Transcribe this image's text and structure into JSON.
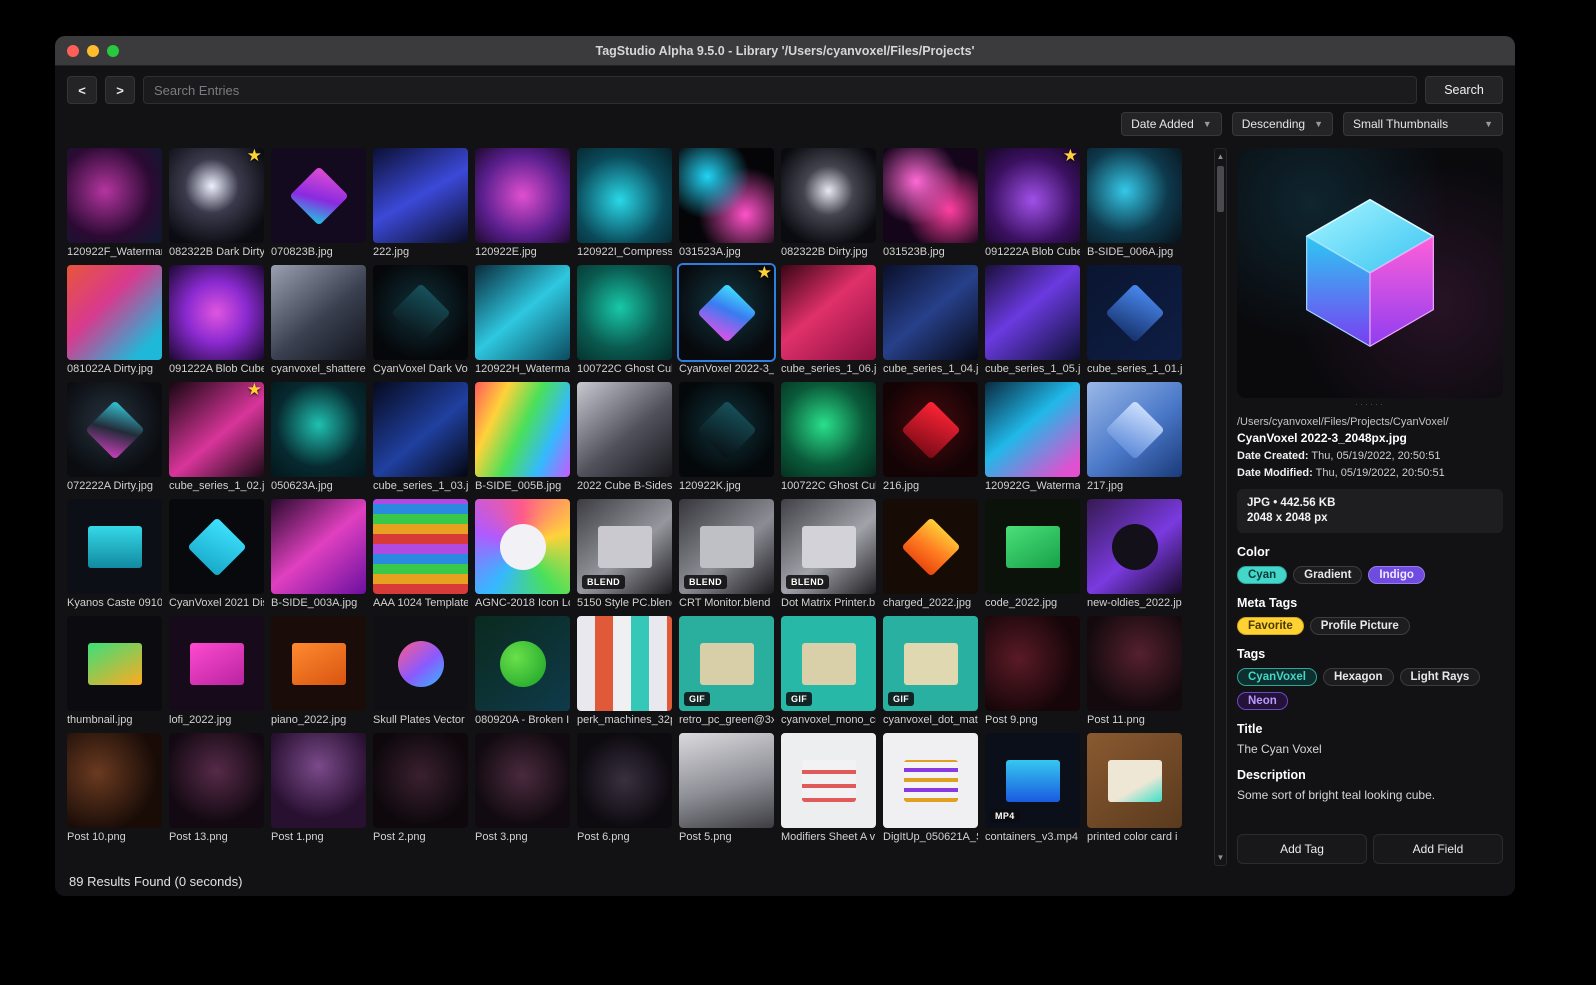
{
  "window": {
    "title": "TagStudio Alpha 9.5.0 - Library '/Users/cyanvoxel/Files/Projects'",
    "status": "89 Results Found (0 seconds)"
  },
  "toolbar": {
    "back": "<",
    "forward": ">",
    "search_placeholder": "Search Entries",
    "search_button": "Search"
  },
  "filters": {
    "sort_field": "Date Added",
    "sort_order": "Descending",
    "thumb_size": "Small Thumbnails"
  },
  "colors": {
    "accent_selection": "#2e7fe0",
    "star": "#ffd234"
  },
  "grid": {
    "items": [
      {
        "name": "120922F_Watermar",
        "bg": "radial-gradient(circle at 40% 45%,#b435a0,#2b0a33 60%,#0c1b2e)"
      },
      {
        "name": "082322B Dark Dirty",
        "bg": "radial-gradient(circle at 45% 40%,#eef0ff,#3a3a4c 35%,#0b0b12 80%)",
        "badge": "star"
      },
      {
        "name": "070823B.jpg",
        "bg": "#140a20",
        "fg": "linear-gradient(150deg,#e14fd0,#8a2ae0 55%,#20c8e0)"
      },
      {
        "name": "222.jpg",
        "bg": "linear-gradient(150deg,#0b1033,#3b49d8 50%,#0a0d22)"
      },
      {
        "name": "120922E.jpg",
        "bg": "radial-gradient(circle at 50% 50%,#e04fd0,#5a1f8e 60%,#1e0a2e)"
      },
      {
        "name": "120922I_Compresse",
        "bg": "radial-gradient(circle at 45% 55%,#29d8e8,#0a4a5a 60%,#072028)"
      },
      {
        "name": "031523A.jpg",
        "bg": "radial-gradient(circle at 30% 30%,#22d4f5,rgba(0,0,0,0) 45%),radial-gradient(circle at 70% 70%,#ff52c8,rgba(0,0,0,0) 50%),#050508"
      },
      {
        "name": "082322B Dirty.jpg",
        "bg": "radial-gradient(circle at 50% 45%,#e8e8f2,#44444f 35%,#0a0a10 80%)"
      },
      {
        "name": "031523B.jpg",
        "bg": "radial-gradient(circle at 35% 35%,#ff6ad5,rgba(0,0,0,0) 50%),radial-gradient(circle at 70% 65%,#ff3fa0,rgba(0,0,0,0) 50%),#14051a"
      },
      {
        "name": "091222A Blob Cube",
        "bg": "radial-gradient(circle at 50% 55%,#a050e8,#3a1060 60%,#140720)",
        "badge": "star"
      },
      {
        "name": "B-SIDE_006A.jpg",
        "bg": "radial-gradient(circle at 40% 45%,#35c8e8,#0e3a4d 55%,#081018)"
      },
      {
        "name": "081022A Dirty.jpg",
        "bg": "linear-gradient(135deg,#e8553a 0%,#d83a8e 40%,#20b8d8 85%)"
      },
      {
        "name": "091222A Blob Cube",
        "bg": "radial-gradient(circle at 50% 50%,#e055e0,#8a2ad0 45%,#1a0830)"
      },
      {
        "name": "cyanvoxel_shattere",
        "bg": "linear-gradient(140deg,#9aa0b0,#3a4050 55%,#12141c)"
      },
      {
        "name": "CyanVoxel Dark Vox",
        "bg": "radial-gradient(circle at 50% 45%,#0f3038,#05070a 75%)",
        "fg": "linear-gradient(160deg,#17535e,#0a1418)"
      },
      {
        "name": "120922H_Waterma",
        "bg": "linear-gradient(140deg,#0a2a3a,#2ec8e0 50%,#0c4a5e)"
      },
      {
        "name": "100722C Ghost Cub",
        "bg": "radial-gradient(circle at 45% 45%,#18c8a8,#0a5a50 55%,#042a28)"
      },
      {
        "name": "CyanVoxel 2022-3_",
        "bg": "radial-gradient(circle at 50% 42%,#123741,#07090d 75%)",
        "fg": "linear-gradient(160deg,#3fe2ff 0%,#3a7bf0 45%,#e052e8 100%)",
        "badge": "star",
        "sel": true
      },
      {
        "name": "cube_series_1_06.j",
        "bg": "linear-gradient(140deg,#3a0515,#e0306a 45%,#8a1040)"
      },
      {
        "name": "cube_series_1_04.j",
        "bg": "linear-gradient(140deg,#0a0f2a,#27408a 50%,#060814)"
      },
      {
        "name": "cube_series_1_05.j",
        "bg": "linear-gradient(140deg,#1a0f3a,#6a3ae0 45%,#0c1030)"
      },
      {
        "name": "cube_series_1_01.j",
        "bg": "linear-gradient(140deg,#0a1530,#0e1d44)",
        "fg": "linear-gradient(160deg,#4a8af0,#16306a)"
      },
      {
        "name": "072222A Dirty.jpg",
        "bg": "radial-gradient(circle at 45% 42%,#26323e,#0a0c10 72%)",
        "fg": "linear-gradient(150deg,#35c8d8,#232b38 50%,#d040c0)"
      },
      {
        "name": "cube_series_1_02.j",
        "bg": "linear-gradient(140deg,#16060f,#d8359a 55%,#1a0a14)",
        "badge": "star"
      },
      {
        "name": "050623A.jpg",
        "bg": "radial-gradient(circle at 50% 45%,#20c0b0,#062a30 60%,#03161a)"
      },
      {
        "name": "cube_series_1_03.j",
        "bg": "linear-gradient(140deg,#060a1e,#2040a0 55%,#04060f)"
      },
      {
        "name": "B-SIDE_005B.jpg",
        "bg": "linear-gradient(115deg,#ff5a5a 0%,#ffd23a 25%,#4ae05a 50%,#35b8ff 75%,#c85aff 100%)"
      },
      {
        "name": "2022 Cube B-Sides",
        "bg": "linear-gradient(140deg,#c9c9d2,#51515c 55%,#17171c)"
      },
      {
        "name": "120922K.jpg",
        "bg": "radial-gradient(circle at 50% 45%,#10343c,#04080a 72%)",
        "fg": "linear-gradient(160deg,#17525c,#081014)"
      },
      {
        "name": "100722C Ghost Cub",
        "bg": "radial-gradient(circle at 45% 45%,#2ae08a,#0a5a3a 55%,#04261a)"
      },
      {
        "name": "216.jpg",
        "bg": "radial-gradient(circle at 50% 45%,#4a0a0e,#130305 72%)",
        "fg": "linear-gradient(160deg,#ff2436,#7a0a16)"
      },
      {
        "name": "120922G_Waterma",
        "bg": "linear-gradient(140deg,#0a2a40,#20b8e8 45%,#e050d0 90%)"
      },
      {
        "name": "217.jpg",
        "bg": "linear-gradient(140deg,#9ab8e8,#4a78c8 55%,#1a3a7a)",
        "fg": "linear-gradient(160deg,#cfe2ff,#5a88d8)"
      },
      {
        "name": "Kyanos Caste 0910",
        "bg": "#0c1016",
        "fg": "linear-gradient(180deg,#35d8e8,#128aa0)",
        "fs": "s"
      },
      {
        "name": "CyanVoxel 2021 Dis",
        "bg": "#08090c",
        "fg": "linear-gradient(160deg,#3fe2ff,#18a8c8)"
      },
      {
        "name": "B-SIDE_003A.jpg",
        "bg": "linear-gradient(140deg,#2a0a2e,#e040c0 50%,#6a10a0)"
      },
      {
        "name": "AAA 1024 Template",
        "bg": "repeating-linear-gradient(0deg,#d83a3a 0 10px,#e8a020 10px 20px,#3ac84a 20px 30px,#2a8ae0 30px 40px,#b04ae0 40px 50px)"
      },
      {
        "name": "AGNC-2018 Icon Lo",
        "bg": "conic-gradient(from 0deg,#ff5a8a,#ffd23a,#4ae05a,#35b8ff,#b05aff,#ff5a8a)",
        "fg": "#f2f2f6",
        "fs": "c"
      },
      {
        "name": "5150 Style PC.blend",
        "bg": "linear-gradient(140deg,#3c3c42,#96969e 55%,#1c1c20)",
        "fg": "#c9c9cf",
        "fs": "s",
        "badge": "BLEND"
      },
      {
        "name": "CRT Monitor.blend",
        "bg": "linear-gradient(140deg,#36363c,#8c8c94 55%,#1a1a1e)",
        "fg": "#bfbfc6",
        "fs": "s",
        "badge": "BLEND"
      },
      {
        "name": "Dot Matrix Printer.b",
        "bg": "linear-gradient(140deg,#404046,#a2a2aa 55%,#202024)",
        "fg": "#d2d2d8",
        "fs": "s",
        "badge": "BLEND"
      },
      {
        "name": "charged_2022.jpg",
        "bg": "#160b05",
        "fg": "linear-gradient(170deg,#ffd23a,#ff7a20 55%,#e8440e)"
      },
      {
        "name": "code_2022.jpg",
        "bg": "#0a120a",
        "fg": "linear-gradient(150deg,#4ae07a,#17a048)",
        "fs": "s"
      },
      {
        "name": "new-oldies_2022.jp",
        "bg": "linear-gradient(140deg,#351a50,#7a3ae0 55%,#180a28)",
        "fg": "#14101a",
        "fs": "c"
      },
      {
        "name": "thumbnail.jpg",
        "bg": "#0c0c10",
        "fg": "linear-gradient(150deg,#3ae07a,#ffaa20)",
        "fs": "s"
      },
      {
        "name": "lofi_2022.jpg",
        "bg": "#170a1a",
        "fg": "linear-gradient(150deg,#ff4ad0,#b824a0)",
        "fs": "s"
      },
      {
        "name": "piano_2022.jpg",
        "bg": "#1a0c08",
        "fg": "linear-gradient(150deg,#ff8a30,#d85510)",
        "fs": "s"
      },
      {
        "name": "Skull Plates Vector",
        "bg": "#0f0f14",
        "fg": "linear-gradient(140deg,#ff5a8a,#8a5aff 55%,#35b8ff)",
        "fs": "c"
      },
      {
        "name": "080920A - Broken I",
        "bg": "linear-gradient(140deg,#0a2a1e,#0f3a4a)",
        "fg": "radial-gradient(circle at 35% 35%,#6ae04a,#18a028)",
        "fs": "c"
      },
      {
        "name": "perk_machines_32p",
        "bg": "repeating-linear-gradient(90deg,#e8e8ee 0 18px,#e05a3a 18px 36px,#f0f0f2 36px 54px,#35c8b8 54px 72px)"
      },
      {
        "name": "retro_pc_green@3x",
        "bg": "#2aaf9e",
        "fg": "#d8cfa8",
        "fs": "s",
        "badge": "GIF"
      },
      {
        "name": "cyanvoxel_mono_cr",
        "bg": "#27b8a8",
        "fg": "#d9d0aa",
        "fs": "s",
        "badge": "GIF"
      },
      {
        "name": "cyanvoxel_dot_mat",
        "bg": "#2ab0a0",
        "fg": "#e0d8b0",
        "fs": "s",
        "badge": "GIF"
      },
      {
        "name": "Post 9.png",
        "bg": "radial-gradient(circle at 35% 45%,#5a1a26,#170609 70%)"
      },
      {
        "name": "Post 11.png",
        "bg": "radial-gradient(circle at 55% 40%,#55202e,#140a0e 70%)"
      },
      {
        "name": "Post 10.png",
        "bg": "radial-gradient(circle at 32% 42%,#6a3a20,#190c07 70%)"
      },
      {
        "name": "Post 13.png",
        "bg": "radial-gradient(circle at 50% 40%,#562a48,#130912 70%)"
      },
      {
        "name": "Post 1.png",
        "bg": "radial-gradient(circle at 50% 35%,#7a4a8a,#281030 68%)"
      },
      {
        "name": "Post 2.png",
        "bg": "radial-gradient(circle at 50% 45%,#3a2030,#0e080c 70%)"
      },
      {
        "name": "Post 3.png",
        "bg": "radial-gradient(circle at 50% 45%,#4a2a3e,#110a10 70%)"
      },
      {
        "name": "Post 6.png",
        "bg": "radial-gradient(circle at 50% 50%,#39303f,#0d0a10 70%)"
      },
      {
        "name": "Post 5.png",
        "bg": "linear-gradient(165deg,#dadade,#8e8e96 55%,#3c3c42)"
      },
      {
        "name": "Modifiers Sheet A v",
        "bg": "#eceef0",
        "fg": "repeating-linear-gradient(0deg,#e05a5a 0 4px,#f2f2f4 4px 14px)",
        "fs": "s"
      },
      {
        "name": "DigItUp_050621A_S",
        "bg": "#f0f0f2",
        "fg": "repeating-linear-gradient(0deg,#e0a020 0 4px,#f4f4f6 4px 10px,#8a3ae0 10px 14px,#f4f4f6 14px 20px)",
        "fs": "s"
      },
      {
        "name": "containers_v3.mp4",
        "bg": "#0a0f1a",
        "fg": "linear-gradient(180deg,#35c8f0,#1a5ae0)",
        "fs": "s",
        "badge": "MP4"
      },
      {
        "name": "printed color card i",
        "bg": "linear-gradient(140deg,#8a5a30,#5a3a1e)",
        "fg": "linear-gradient(150deg,#efe7d6 60%,#3ae0c8)",
        "fs": "s"
      }
    ]
  },
  "panel": {
    "preview_dots": "······",
    "path": "/Users/cyanvoxel/Files/Projects/CyanVoxel/",
    "filename": "CyanVoxel 2022-3_2048px.jpg",
    "date_created_label": "Date Created:",
    "date_created": "Thu, 05/19/2022, 20:50:51",
    "date_modified_label": "Date Modified:",
    "date_modified": "Thu, 05/19/2022, 20:50:51",
    "file_type_size": "JPG  •  442.56 KB",
    "dimensions": "2048 x 2048 px",
    "sections": {
      "color": {
        "label": "Color",
        "pills": [
          {
            "label": "Cyan",
            "style": "cyan"
          },
          {
            "label": "Gradient",
            "style": "dark"
          },
          {
            "label": "Indigo",
            "style": "indigo"
          }
        ]
      },
      "meta": {
        "label": "Meta Tags",
        "pills": [
          {
            "label": "Favorite",
            "style": "yellow"
          },
          {
            "label": "Profile Picture",
            "style": "dark"
          }
        ]
      },
      "tags": {
        "label": "Tags",
        "pills": [
          {
            "label": "CyanVoxel",
            "style": "teal-outline"
          },
          {
            "label": "Hexagon",
            "style": "dark"
          },
          {
            "label": "Light Rays",
            "style": "dark"
          },
          {
            "label": "Neon",
            "style": "purple-outline"
          }
        ]
      }
    },
    "title_label": "Title",
    "title_value": "The Cyan Voxel",
    "desc_label": "Description",
    "desc_value": "Some sort of bright teal looking cube.",
    "add_tag": "Add Tag",
    "add_field": "Add Field"
  }
}
